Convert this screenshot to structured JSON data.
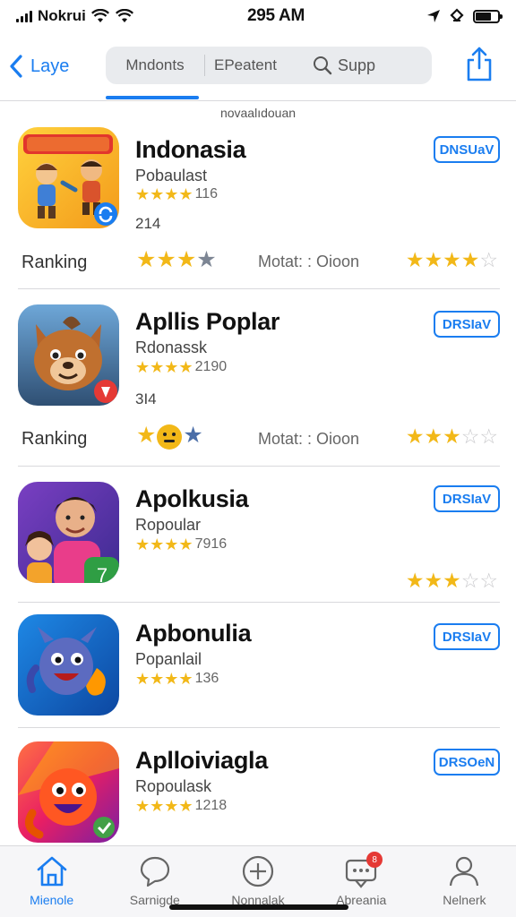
{
  "status_bar": {
    "carrier": "Nokrui",
    "time": "295 AM"
  },
  "nav": {
    "back_label": "Laye",
    "segments": [
      "Mndonts",
      "EPeatent"
    ],
    "search_label": "Supp"
  },
  "section_caption": "novaalıdouan",
  "apps": [
    {
      "title": "Indonasia",
      "subtitle": "Pobaulast",
      "rating_text": "116",
      "count": "214",
      "get_label": "DNSUaV",
      "ranking_label": "Ranking",
      "mid_label": "Motat: : Oioon",
      "stars": 4
    },
    {
      "title": "Apllis Poplar",
      "subtitle": "Rdonassk",
      "rating_text": "2190",
      "count": "3I4",
      "get_label": "DRSIaV",
      "ranking_label": "Ranking",
      "mid_label": "Motat: : Oioon",
      "stars": 4
    },
    {
      "title": "Apolkusia",
      "subtitle": "Ropoular",
      "rating_text": "7916",
      "get_label": "DRSIaV",
      "stars": 4
    },
    {
      "title": "Apbonulia",
      "subtitle": "Popanlail",
      "rating_text": "136",
      "get_label": "DRSIaV",
      "stars": 4
    },
    {
      "title": "Aplloiviagla",
      "subtitle": "Ropoulask",
      "rating_text": "1218",
      "get_label": "DRSOeN",
      "stars": 4
    }
  ],
  "tabs": [
    {
      "label": "Mienole",
      "icon": "home-icon"
    },
    {
      "label": "Sarnigde",
      "icon": "chat-icon"
    },
    {
      "label": "Nonnalak",
      "icon": "plus-circle-icon"
    },
    {
      "label": "Abreania",
      "icon": "message-icon",
      "badge": "8"
    },
    {
      "label": "Nelnerk",
      "icon": "person-icon"
    }
  ],
  "colors": {
    "accent": "#1a7df0",
    "star": "#f2b818",
    "badge": "#e53935"
  }
}
